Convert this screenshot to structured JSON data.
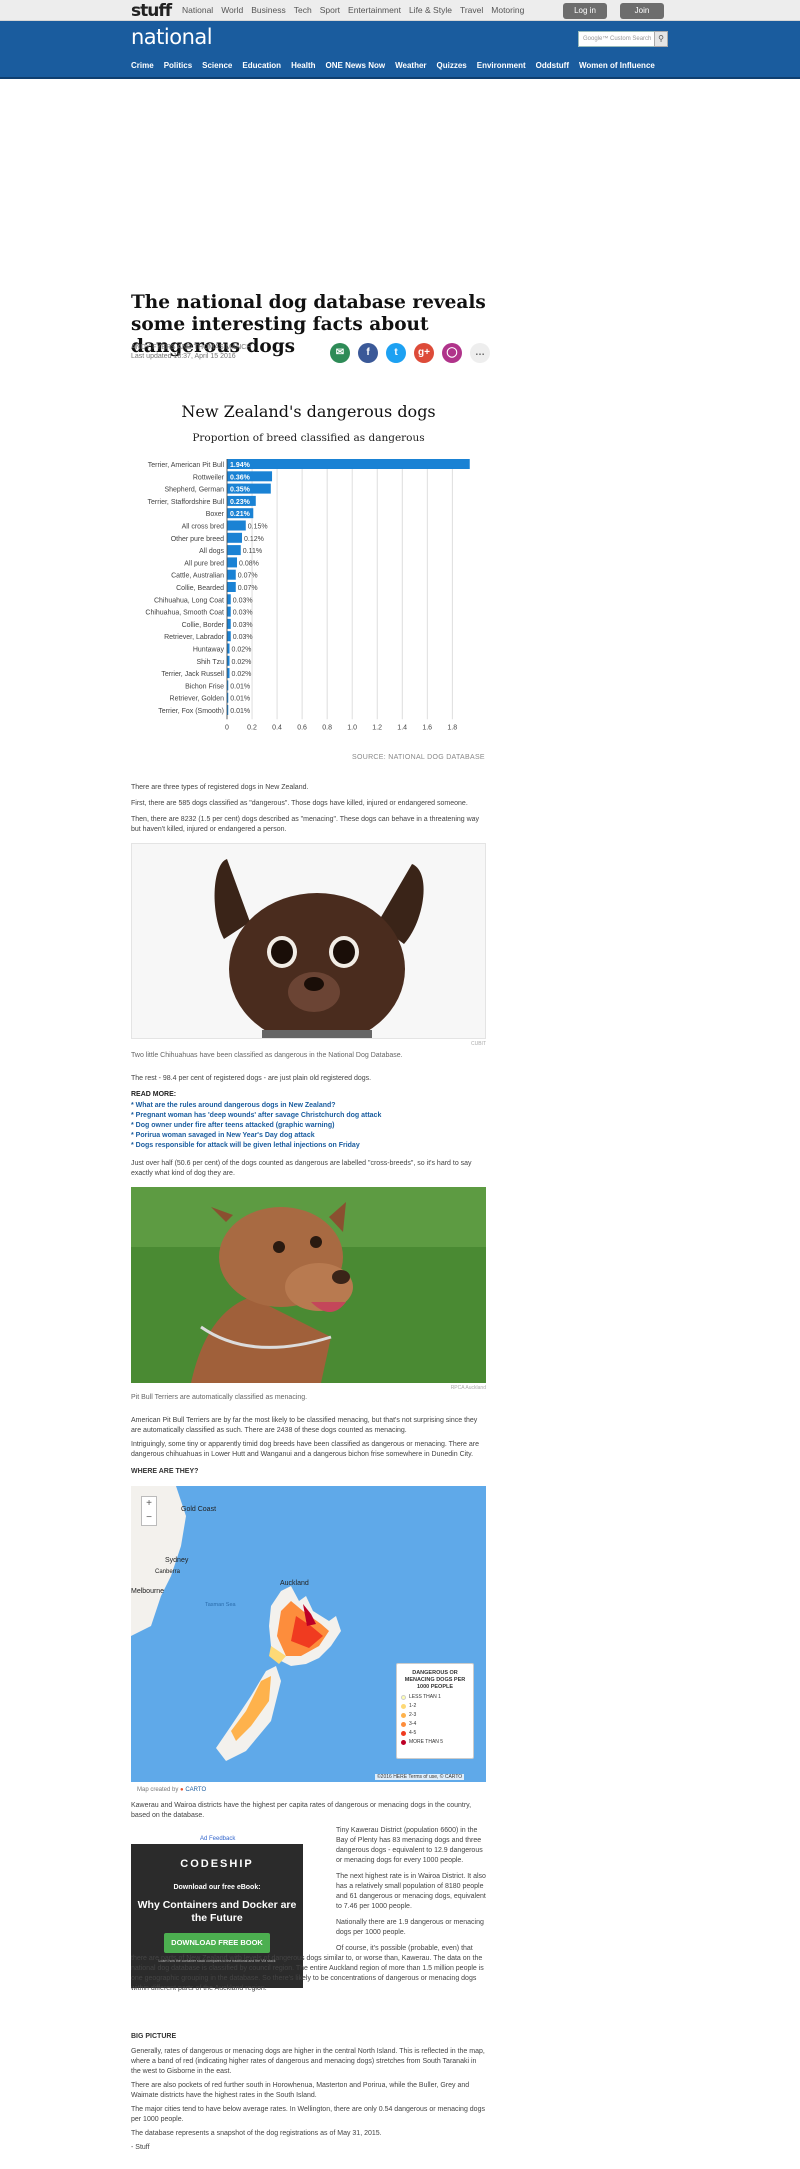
{
  "site": {
    "logo": "stuff",
    "top_nav": [
      "National",
      "World",
      "Business",
      "Tech",
      "Sport",
      "Entertainment",
      "Life & Style",
      "Travel",
      "Motoring"
    ],
    "login_label": "Log in",
    "join_label": "Join",
    "section": "national",
    "search_placeholder": "Google™ Custom Search",
    "categories": [
      "Crime",
      "Politics",
      "Science",
      "Education",
      "Health",
      "ONE News Now",
      "Weather",
      "Quizzes",
      "Environment",
      "Oddstuff",
      "Women of Influence"
    ],
    "colors": {
      "header": "#1a5c9e",
      "bar": "#1a82d4",
      "link": "#1a5c9e"
    }
  },
  "article": {
    "headline": "The national dog database reveals some interesting facts about dangerous dogs",
    "byline": "ANDY FYERS AND THOMAS MANCH",
    "updated": "Last updated 18:37, April 15 2016",
    "share_icons": [
      "email-icon",
      "facebook-icon",
      "twitter-icon",
      "google-plus-icon",
      "messenger-icon",
      "more-icon"
    ],
    "p1": "There are three types of registered dogs in New Zealand.",
    "p2": "First, there are 585 dogs classified as \"dangerous\". Those dogs have killed, injured or endangered someone.",
    "p3": "Then, there are 8232 (1.5 per cent) dogs described as \"menacing\". These dogs can behave in a threatening way but haven't killed, injured or endangered a person.",
    "photo1_caption": "Two little Chihuahuas have been classified as dangerous in the National Dog Database.",
    "photo1_credit": "CUBIT",
    "p4": "The rest - 98.4 per cent of registered dogs - are just plain old registered dogs.",
    "read_more_title": "READ MORE:",
    "read_more": [
      "* What are the rules around dangerous dogs in New Zealand?",
      "* Pregnant woman has 'deep wounds' after savage Christchurch dog attack",
      "* Dog owner under fire after teens attacked (graphic warning)",
      "* Porirua woman savaged in New Year's Day dog attack",
      "* Dogs responsible for attack will be given lethal injections on Friday"
    ],
    "p5": "Just over half (50.6 per cent) of the dogs counted as dangerous are labelled \"cross-breeds\", so it's hard to say exactly what kind of dog they are.",
    "photo2_caption": "Pit Bull Terriers are automatically classified as menacing.",
    "photo2_credit": "RPCA Auckland",
    "p6": "American Pit Bull Terriers are by far the most likely to be classified menacing, but that's not surprising since they are automatically classified as such. There are 2438 of these dogs counted as menacing.",
    "p7": "Intriguingly, some tiny or apparently timid dog breeds have been classified as dangerous or menacing. There are dangerous chihuahuas in Lower Hutt and Wanganui and a dangerous bichon frise somewhere in Dunedin City.",
    "where_heading": "WHERE ARE THEY?",
    "map": {
      "labels": [
        "Gold Coast",
        "Sydney",
        "Canberra",
        "Melbourne",
        "Tasman Sea",
        "Auckland"
      ],
      "legend_title": "DANGEROUS OR MENACING DOGS PER 1000 PEOPLE",
      "legend": [
        {
          "label": "LESS THAN 1",
          "color": "#ffffb2"
        },
        {
          "label": "1-2",
          "color": "#fed976"
        },
        {
          "label": "2-3",
          "color": "#feb24c"
        },
        {
          "label": "3-4",
          "color": "#fd8d3c"
        },
        {
          "label": "4-5",
          "color": "#f03b20"
        },
        {
          "label": "MORE THAN 5",
          "color": "#bd0026"
        }
      ],
      "attribution": "©2016 HERE Terms of use, © CARTO",
      "created_by": "Map created by",
      "created_by_brand": "CARTO"
    },
    "p8": "Kawerau and Wairoa districts have the highest per capita rates of dangerous or menacing dogs in the country, based on the database.",
    "ad": {
      "feedback": "Ad Feedback",
      "brand": "CODESHIP",
      "line1": "Download our free eBook:",
      "line2": "Why Containers and Docker are the Future",
      "button": "DOWNLOAD FREE BOOK",
      "small": "Learn how the container stack compares to the traditional and the VM stack"
    },
    "side1": "Tiny Kawerau District (population 6600) in the Bay of Plenty has 83 menacing dogs and three dangerous dogs - equivalent to 12.9 dangerous or menacing dogs for every 1000 people.",
    "side2": "The next highest rate is in Wairoa District. It also has a relatively small population of 8180 people and 61 dangerous or menacing dogs, equivalent to 7.46 per 1000 people.",
    "side3": "Nationally there are 1.9 dangerous or menacing dogs per 1000 people.",
    "side4": "Of course, it's possible (probable, even) that there are parts of New Zealand with levels of dangerous dogs similar to, or worse than, Kawerau. The data on the national dog database is classified by council region. The entire Auckland region of more than 1.5 million people is one geographic grouping in the database. So there's likely to be concentrations of dangerous or menacing dogs within different parts of the Auckland region.",
    "big_picture": "BIG PICTURE",
    "p9": "Generally, rates of dangerous or menacing dogs are higher in the central North Island. This is reflected in the map, where a band of red (indicating higher rates of dangerous and menacing dogs) stretches from South Taranaki in the west to Gisborne in the east.",
    "p10": "There are also pockets of red further south in Horowhenua, Masterton and Porirua, while the Buller, Grey and Waimate districts have the highest rates in the South Island.",
    "p11": "The major cities tend to have below average rates. In Wellington, there are only 0.54 dangerous or menacing dogs per 1000 people.",
    "p12": "The database represents a snapshot of the dog registrations as of May 31, 2015.",
    "signoff": "- Stuff"
  },
  "chart_data": {
    "type": "bar",
    "title": "New Zealand's dangerous dogs",
    "subtitle": "Proportion of breed classified as dangerous",
    "source": "SOURCE: NATIONAL DOG DATABASE",
    "orientation": "horizontal",
    "categories": [
      "Terrier, American Pit Bull",
      "Rottweiler",
      "Shepherd, German",
      "Terrier, Staffordshire Bull",
      "Boxer",
      "All cross bred",
      "Other pure breed",
      "All dogs",
      "All pure bred",
      "Cattle, Australian",
      "Collie, Bearded",
      "Chihuahua, Long Coat",
      "Chihuahua, Smooth Coat",
      "Collie, Border",
      "Retriever, Labrador",
      "Huntaway",
      "Shih Tzu",
      "Terrier, Jack Russell",
      "Bichon Frise",
      "Retriever, Golden",
      "Terrier, Fox (Smooth)"
    ],
    "values": [
      1.94,
      0.36,
      0.35,
      0.23,
      0.21,
      0.15,
      0.12,
      0.11,
      0.08,
      0.07,
      0.07,
      0.03,
      0.03,
      0.03,
      0.03,
      0.02,
      0.02,
      0.02,
      0.01,
      0.01,
      0.01
    ],
    "value_labels": [
      "1.94%",
      "0.36%",
      "0.35%",
      "0.23%",
      "0.21%",
      "0.15%",
      "0.12%",
      "0.11%",
      "0.08%",
      "0.07%",
      "0.07%",
      "0.03%",
      "0.03%",
      "0.03%",
      "0.03%",
      "0.02%",
      "0.02%",
      "0.02%",
      "0.01%",
      "0.01%",
      "0.01%"
    ],
    "x_ticks": [
      "0",
      "0.2",
      "0.4",
      "0.6",
      "0.8",
      "1.0",
      "1.2",
      "1.4",
      "1.6",
      "1.8"
    ],
    "xlim": [
      0,
      1.95
    ],
    "grid": true,
    "bar_color": "#1a82d4"
  }
}
